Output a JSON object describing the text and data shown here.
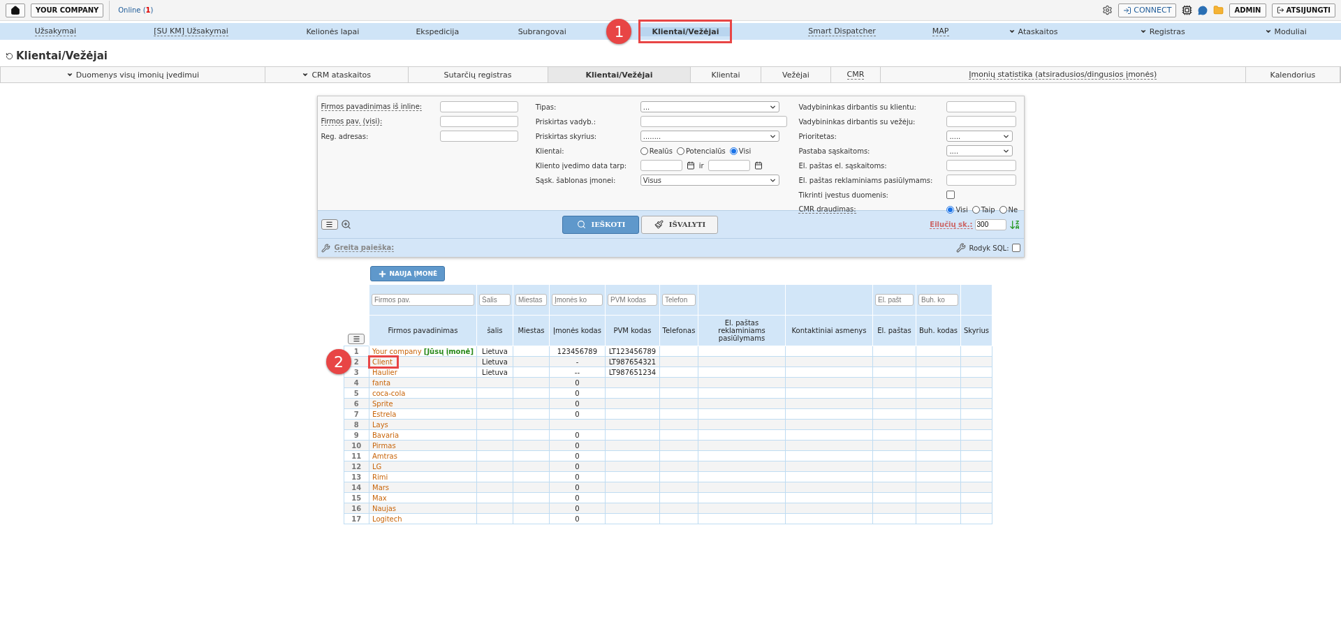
{
  "top_bar": {
    "company_button": "YOUR COMPANY",
    "online": {
      "before": "Online (",
      "count": "1",
      "after": ")"
    },
    "connect_button": "CONNECT",
    "admin_button": "ADMIN",
    "logout_button": "ATSIJUNGTI"
  },
  "nav": [
    {
      "label": "Užsakymai",
      "dropdown": false,
      "underlined": true,
      "selected": false
    },
    {
      "label": "[SU KM] Užsakymai",
      "dropdown": false,
      "underlined": true,
      "selected": false
    },
    {
      "label": "Kelionės lapai",
      "dropdown": false,
      "underlined": false,
      "selected": false
    },
    {
      "label": "Ekspedicija",
      "dropdown": false,
      "underlined": false,
      "selected": false
    },
    {
      "label": "Subrangovai",
      "dropdown": false,
      "underlined": false,
      "selected": false
    },
    {
      "label": "Klientai/Vežėjai",
      "dropdown": false,
      "underlined": false,
      "selected": true,
      "callout": "1"
    },
    {
      "label": "Smart Dispatcher",
      "dropdown": false,
      "underlined": true,
      "selected": false
    },
    {
      "label": "MAP",
      "dropdown": false,
      "underlined": true,
      "selected": false
    },
    {
      "label": "Ataskaitos",
      "dropdown": true,
      "underlined": false,
      "selected": false
    },
    {
      "label": "Registras",
      "dropdown": true,
      "underlined": false,
      "selected": false
    },
    {
      "label": "Moduliai",
      "dropdown": true,
      "underlined": false,
      "selected": false
    }
  ],
  "page_title": "Klientai/Vežėjai",
  "sub_tabs": [
    {
      "label": "Duomenys visų imonių įvedimui",
      "dropdown": true,
      "underlined": false,
      "selected": false
    },
    {
      "label": "CRM ataskaitos",
      "dropdown": true,
      "underlined": false,
      "selected": false
    },
    {
      "label": "Sutarčių registras",
      "dropdown": false,
      "underlined": false,
      "selected": false
    },
    {
      "label": "Klientai/Vežėjai",
      "dropdown": false,
      "underlined": false,
      "selected": true
    },
    {
      "label": "Klientai",
      "dropdown": false,
      "underlined": false,
      "selected": false
    },
    {
      "label": "Vežėjai",
      "dropdown": false,
      "underlined": false,
      "selected": false
    },
    {
      "label": "CMR",
      "dropdown": false,
      "underlined": true,
      "selected": false
    },
    {
      "label": "Įmonių statistika (atsiradusios/dingusios įmonės)",
      "dropdown": false,
      "underlined": true,
      "selected": false
    },
    {
      "label": "Kalendorius",
      "dropdown": false,
      "underlined": false,
      "selected": false
    }
  ],
  "filters": {
    "columns": [
      {
        "fields": [
          {
            "kind": "text",
            "label": "Firmos pavadinimas iš inline:",
            "underlined": true
          },
          {
            "kind": "text",
            "label": "Firmos pav. (visi):",
            "underlined": true
          },
          {
            "kind": "text",
            "label": "Reg. adresas:",
            "underlined": false
          }
        ]
      },
      {
        "fields": [
          {
            "kind": "select",
            "label": "Tipas:",
            "underlined": false,
            "value": "..."
          },
          {
            "kind": "text",
            "label": "Priskirtas vadyb.:",
            "underlined": false
          },
          {
            "kind": "select",
            "label": "Priskirtas skyrius:",
            "underlined": false,
            "value": "........"
          },
          {
            "kind": "radio",
            "label": "Klientai:",
            "underlined": false,
            "options": [
              {
                "label": "Realūs",
                "selected": false
              },
              {
                "label": "Potencialūs",
                "selected": false
              },
              {
                "label": "Visi",
                "selected": true
              }
            ]
          },
          {
            "kind": "date_range",
            "label": "Kliento įvedimo data tarp:",
            "underlined": false,
            "separator": "ir"
          },
          {
            "kind": "select",
            "label": "Sąsk. šablonas įmonei:",
            "underlined": false,
            "value": "Visus"
          }
        ]
      },
      {
        "fields": [
          {
            "kind": "text",
            "label": "Vadybininkas dirbantis su klientu:",
            "underlined": false
          },
          {
            "kind": "text",
            "label": "Vadybininkas dirbantis su vežėju:",
            "underlined": false
          },
          {
            "kind": "select",
            "label": "Prioritetas:",
            "underlined": false,
            "value": "....."
          },
          {
            "kind": "select",
            "label": "Pastaba sąskaitoms:",
            "underlined": false,
            "value": "...."
          },
          {
            "kind": "text",
            "label": "El. paštas el. sąskaitoms:",
            "underlined": false
          },
          {
            "kind": "text",
            "label": "El. paštas reklaminiams pasiūlymams:",
            "underlined": false
          },
          {
            "kind": "checkbox",
            "label": "Tikrinti įvestus duomenis:",
            "underlined": false,
            "checked": false
          },
          {
            "kind": "radio",
            "label": "CMR draudimas:",
            "underlined": true,
            "options": [
              {
                "label": "Visi",
                "selected": true
              },
              {
                "label": "Taip",
                "selected": false
              },
              {
                "label": "Ne",
                "selected": false
              }
            ]
          }
        ]
      }
    ],
    "search_button": "IEŠKOTI",
    "clear_button": "IŠVALYTI",
    "rows_label": "Eilučių sk.:",
    "rows_value": "300",
    "quick_search": "Greita paieška:",
    "show_sql": {
      "label": "Rodyk SQL:",
      "checked": false
    }
  },
  "new_company_button": "NAUJA ĮMONĖ",
  "table": {
    "columns": [
      {
        "title": "Firmos pavadinimas",
        "placeholder": "Firmos pav."
      },
      {
        "title": "šalis",
        "placeholder": "Šalis"
      },
      {
        "title": "Miestas",
        "placeholder": "Miestas"
      },
      {
        "title": "Įmonės kodas",
        "placeholder": "Įmonės ko"
      },
      {
        "title": "PVM kodas",
        "placeholder": "PVM kodas"
      },
      {
        "title": "Telefonas",
        "placeholder": "Telefon"
      },
      {
        "title": "El. paštas reklaminiams pasiūlymams"
      },
      {
        "title": "Kontaktiniai asmenys"
      },
      {
        "title": "El. paštas",
        "placeholder": "El. pašt"
      },
      {
        "title": "Buh. kodas",
        "placeholder": "Buh. ko"
      },
      {
        "title": "Skyrius"
      }
    ],
    "rows": [
      {
        "number": "1",
        "name": "Your company",
        "tag": "[Jūsų įmonė]",
        "country": "Lietuva",
        "code": "123456789",
        "vat": "LT123456789"
      },
      {
        "number": "2",
        "name": "Client",
        "country": "Lietuva",
        "code": "-",
        "vat": "LT987654321",
        "callout": "2"
      },
      {
        "number": "3",
        "name": "Haulier",
        "country": "Lietuva",
        "code": "--",
        "vat": "LT987651234"
      },
      {
        "number": "4",
        "name": "fanta",
        "code": "0"
      },
      {
        "number": "5",
        "name": "coca-cola",
        "code": "0"
      },
      {
        "number": "6",
        "name": "Sprite",
        "code": "0"
      },
      {
        "number": "7",
        "name": "Estrela",
        "code": "0"
      },
      {
        "number": "8",
        "name": "Lays"
      },
      {
        "number": "9",
        "name": "Bavaria",
        "code": "0"
      },
      {
        "number": "10",
        "name": "Pirmas",
        "code": "0"
      },
      {
        "number": "11",
        "name": "Amtras",
        "code": "0"
      },
      {
        "number": "12",
        "name": "LG",
        "code": "0"
      },
      {
        "number": "13",
        "name": "Rimi",
        "code": "0"
      },
      {
        "number": "14",
        "name": "Mars",
        "code": "0"
      },
      {
        "number": "15",
        "name": "Max",
        "code": "0"
      },
      {
        "number": "16",
        "name": "Naujas",
        "code": "0"
      },
      {
        "number": "17",
        "name": "Logitech",
        "code": "0"
      }
    ]
  }
}
